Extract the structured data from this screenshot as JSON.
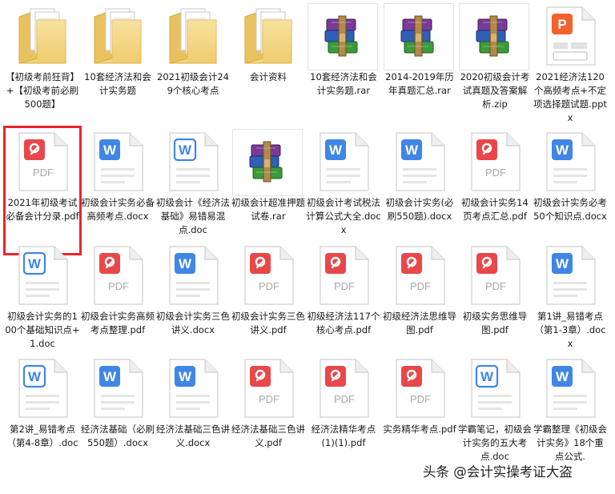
{
  "files": [
    {
      "name": "【初级考前狂背】+【初级考前必刷500题】",
      "type": "folder"
    },
    {
      "name": "10套经济法和会计实务题",
      "type": "folder"
    },
    {
      "name": "2021初级会计249个核心考点",
      "type": "folder"
    },
    {
      "name": "会计资料",
      "type": "folder"
    },
    {
      "name": "10套经济法和会计实务题.rar",
      "type": "rar"
    },
    {
      "name": "2014-2019年历年真题汇总.rar",
      "type": "rar"
    },
    {
      "name": "2020初级会计考试真题及答案解析.zip",
      "type": "rar"
    },
    {
      "name": "2021经济法120个高频考点+不定项选择题试题.pptx",
      "type": "pptx"
    },
    {
      "name": "2021年初级考试必备会计分录.pdf",
      "type": "pdf",
      "selected": true
    },
    {
      "name": "初级会计实务必备高频考点.docx",
      "type": "docx"
    },
    {
      "name": "初级会计《经济法基础》易错易混点.doc",
      "type": "doc"
    },
    {
      "name": "初级会计超准押题试卷.rar",
      "type": "rar"
    },
    {
      "name": "初级会计考试税法计算公式大全.docx",
      "type": "docx"
    },
    {
      "name": "初级会计实务(必刷550题).docx",
      "type": "docx"
    },
    {
      "name": "初级会计实务14页考点汇总.pdf",
      "type": "pdf"
    },
    {
      "name": "初级会计实务必考50个知识点.docx",
      "type": "docx"
    },
    {
      "name": "初级会计实务的100个基础知识点+1.doc",
      "type": "doc"
    },
    {
      "name": "初级会计实务高频考点整理.pdf",
      "type": "pdf"
    },
    {
      "name": "初级会计实务三色讲义.docx",
      "type": "docx"
    },
    {
      "name": "初级会计实务三色讲义.pdf",
      "type": "pdf"
    },
    {
      "name": "初级经济法117个核心考点.pdf",
      "type": "pdf"
    },
    {
      "name": "初级经济法思维导图.pdf",
      "type": "pdf"
    },
    {
      "name": "初级实务思维导图.pdf",
      "type": "pdf"
    },
    {
      "name": "第1讲_易错考点（第1-3章）.docx",
      "type": "docx"
    },
    {
      "name": "第2讲_易错考点（第4-8章）.doc",
      "type": "doc"
    },
    {
      "name": "经济法基础（必刷550题）.docx",
      "type": "docx"
    },
    {
      "name": "经济法基础三色讲义.docx",
      "type": "docx"
    },
    {
      "name": "经济法基础三色讲义.pdf",
      "type": "pdf"
    },
    {
      "name": "经济法精华考点(1)(1).pdf",
      "type": "pdf"
    },
    {
      "name": "实务精华考点.pdf",
      "type": "pdf"
    },
    {
      "name": "学霸笔记，初级会计实务的五大考点.doc",
      "type": "doc"
    },
    {
      "name": "学霸整理《初级会计实务》18个重点公式.",
      "type": "docx"
    }
  ],
  "watermark": "头条 @会计实操考证大盗",
  "colors": {
    "pdf": "#e9474a",
    "word": "#3f86e6",
    "ppt": "#f4612c",
    "folder": "#f3d47c",
    "selection": "#e8242c"
  }
}
